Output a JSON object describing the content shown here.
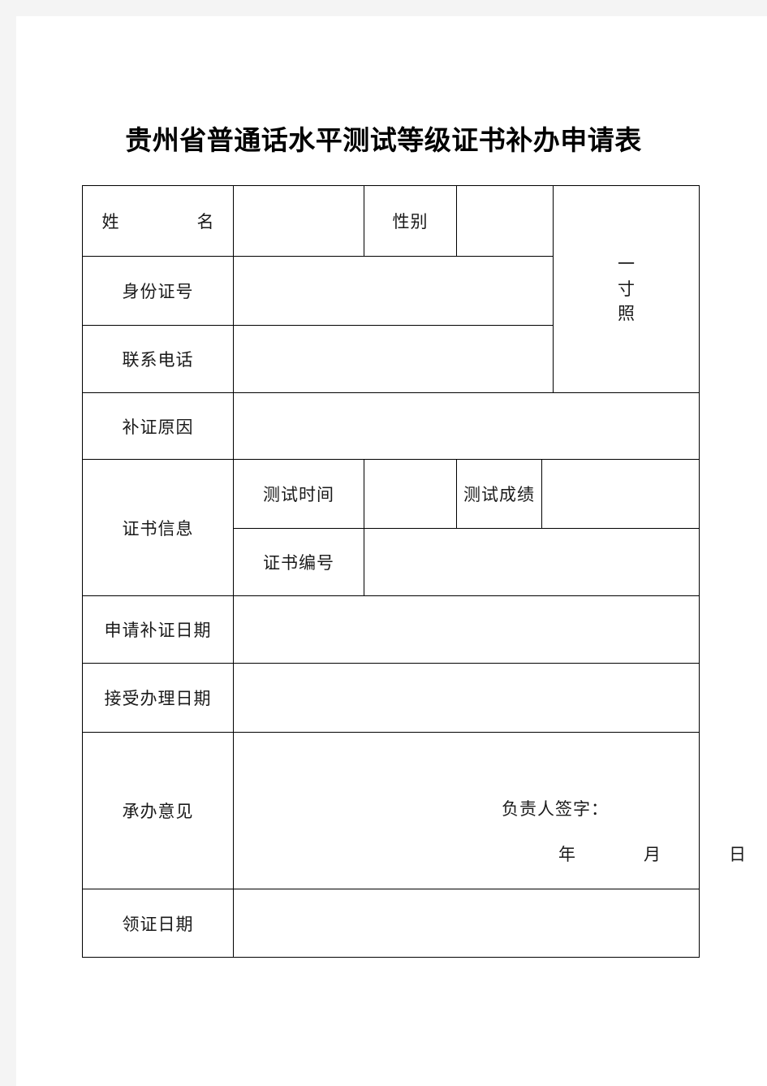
{
  "document": {
    "title": "贵州省普通话水平测试等级证书补办申请表"
  },
  "form": {
    "labels": {
      "name": "姓　　名",
      "gender": "性别",
      "id_number": "身份证号",
      "phone": "联系电话",
      "reason": "补证原因",
      "certificate_info": "证书信息",
      "test_time": "测试时间",
      "test_score": "测试成绩",
      "certificate_number": "证书编号",
      "apply_date": "申请补证日期",
      "accept_date": "接受办理日期",
      "handling_opinion": "承办意见",
      "collect_date": "领证日期"
    },
    "values": {
      "name": "",
      "gender": "",
      "id_number": "",
      "phone": "",
      "reason": "",
      "test_time": "",
      "test_score": "",
      "certificate_number": "",
      "apply_date": "",
      "accept_date": "",
      "collect_date": ""
    },
    "photo_cell": {
      "line1": "一",
      "line2": "寸",
      "line3": "照"
    },
    "opinion": {
      "signature_label": "负责人签字：",
      "date_label": "年　　月　　日"
    }
  },
  "colors": {
    "page_background": "#ffffff",
    "canvas_background": "#f4f4f4",
    "border": "#000000",
    "text": "#1a1a1a",
    "title_text": "#000000"
  }
}
